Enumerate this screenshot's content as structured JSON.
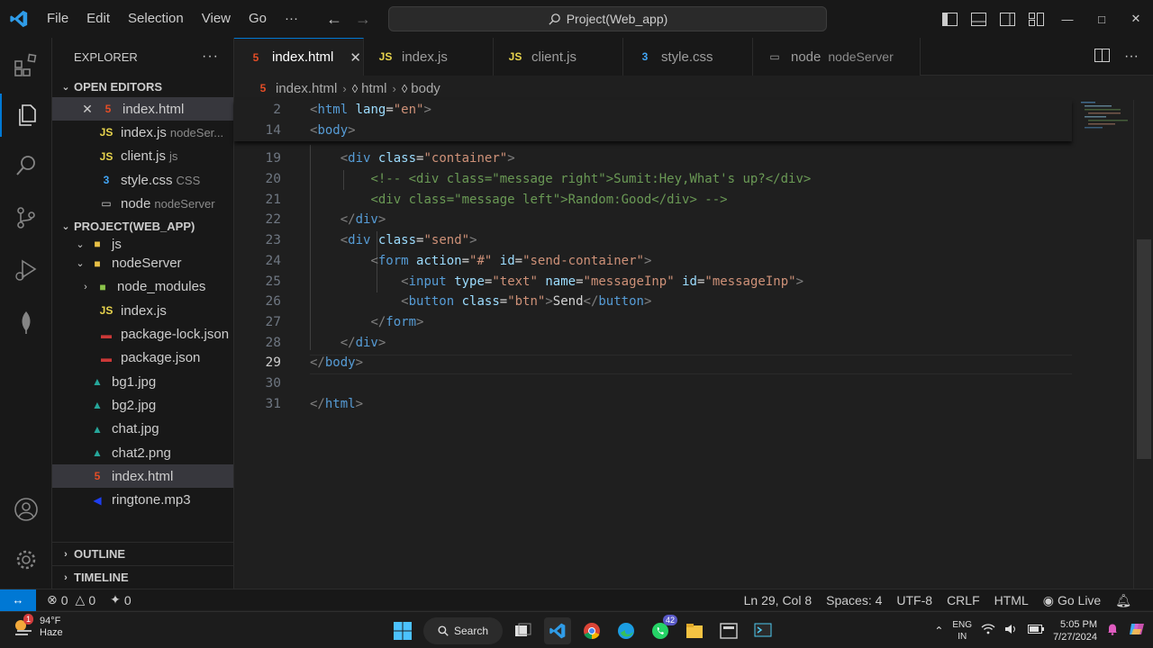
{
  "menu": [
    "File",
    "Edit",
    "Selection",
    "View",
    "Go",
    "···"
  ],
  "command_center": "Project(Web_app)",
  "sidebar": {
    "title": "EXPLORER",
    "open_editors_title": "OPEN EDITORS",
    "open_editors": [
      {
        "name": "index.html",
        "desc": "",
        "icon": "html"
      },
      {
        "name": "index.js",
        "desc": "nodeSer...",
        "icon": "js"
      },
      {
        "name": "client.js",
        "desc": "js",
        "icon": "js"
      },
      {
        "name": "style.css",
        "desc": "CSS",
        "icon": "css"
      },
      {
        "name": "node",
        "desc": "nodeServer",
        "icon": "terminal"
      }
    ],
    "project_title": "PROJECT(WEB_APP)",
    "tree": [
      {
        "name": "js",
        "type": "folder"
      },
      {
        "name": "nodeServer",
        "type": "folder"
      },
      {
        "name": "node_modules",
        "type": "folder"
      },
      {
        "name": "index.js",
        "type": "js"
      },
      {
        "name": "package-lock.json",
        "type": "json"
      },
      {
        "name": "package.json",
        "type": "json"
      },
      {
        "name": "bg1.jpg",
        "type": "img"
      },
      {
        "name": "bg2.jpg",
        "type": "img"
      },
      {
        "name": "chat.jpg",
        "type": "img"
      },
      {
        "name": "chat2.png",
        "type": "img"
      },
      {
        "name": "index.html",
        "type": "html"
      },
      {
        "name": "ringtone.mp3",
        "type": "mp3"
      }
    ],
    "outline": "OUTLINE",
    "timeline": "TIMELINE"
  },
  "tabs": [
    {
      "label": "index.html",
      "desc": "",
      "icon": "5"
    },
    {
      "label": "index.js",
      "desc": "",
      "icon": "JS"
    },
    {
      "label": "client.js",
      "desc": "",
      "icon": "JS"
    },
    {
      "label": "style.css",
      "desc": "",
      "icon": "3"
    },
    {
      "label": "node",
      "desc": "nodeServer",
      "icon": "▭"
    }
  ],
  "breadcrumb": [
    "index.html",
    "html",
    "body"
  ],
  "editor": {
    "sticky": [
      {
        "num": "2",
        "code": "<html lang=\"en\">"
      },
      {
        "num": "14",
        "code": "<body>"
      }
    ],
    "lines": [
      {
        "num": "19",
        "code": "    <div class=\"container\">"
      },
      {
        "num": "20",
        "code": "        <!-- <div class=\"message right\">Sumit:Hey,What's up?</div>"
      },
      {
        "num": "21",
        "code": "        <div class=\"message left\">Random:Good</div> -->"
      },
      {
        "num": "22",
        "code": "    </div>"
      },
      {
        "num": "23",
        "code": "    <div class=\"send\">"
      },
      {
        "num": "24",
        "code": "        <form action=\"#\" id=\"send-container\">"
      },
      {
        "num": "25",
        "code": "            <input type=\"text\" name=\"messageInp\" id=\"messageInp\">"
      },
      {
        "num": "26",
        "code": "            <button class=\"btn\">Send</button>"
      },
      {
        "num": "27",
        "code": "        </form>"
      },
      {
        "num": "28",
        "code": "    </div>"
      },
      {
        "num": "29",
        "code": "</body>"
      },
      {
        "num": "30",
        "code": ""
      },
      {
        "num": "31",
        "code": "</html>"
      }
    ],
    "current_line": "29"
  },
  "status": {
    "errors": "0",
    "warnings": "0",
    "ports": "0",
    "position": "Ln 29, Col 8",
    "spaces": "Spaces: 4",
    "encoding": "UTF-8",
    "eol": "CRLF",
    "language": "HTML",
    "golive": "Go Live"
  },
  "taskbar": {
    "temp": "94°F",
    "condition": "Haze",
    "weather_badge": "1",
    "search": "Search",
    "whatsapp_badge": "42",
    "lang_top": "ENG",
    "lang_bottom": "IN",
    "time": "5:05 PM",
    "date": "7/27/2024"
  },
  "colors": {
    "accent": "#0078d4",
    "tag": "#569cd6",
    "attr": "#9cdcfe",
    "string": "#ce9178",
    "comment": "#6a9955"
  }
}
